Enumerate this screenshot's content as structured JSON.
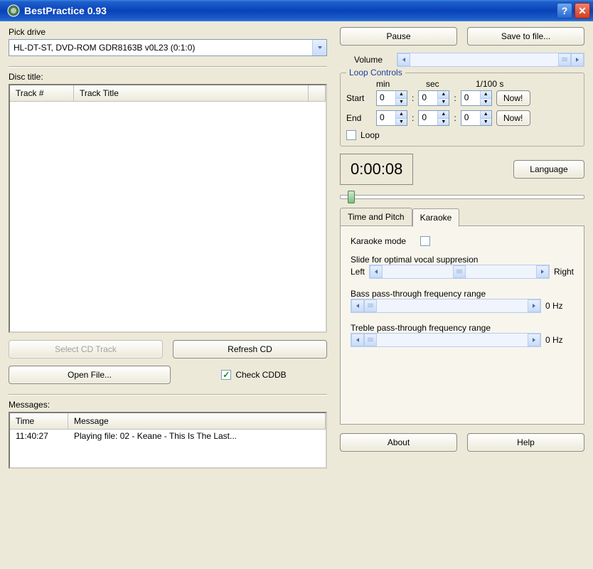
{
  "title": "BestPractice 0.93",
  "left": {
    "pick_drive_label": "Pick drive",
    "drive_value": "HL-DT-ST, DVD-ROM GDR8163B v0L23 (0:1:0)",
    "disc_title_label": "Disc title:",
    "track_num_header": "Track #",
    "track_title_header": "Track Title",
    "select_cd_track": "Select CD Track",
    "refresh_cd": "Refresh CD",
    "open_file": "Open File...",
    "check_cddb": "Check CDDB",
    "messages_label": "Messages:",
    "msg_time_header": "Time",
    "msg_message_header": "Message",
    "msg_time": "11:40:27",
    "msg_text": "Playing file: 02 - Keane - This Is The Last..."
  },
  "right": {
    "pause": "Pause",
    "save_to_file": "Save to file...",
    "volume_label": "Volume",
    "loop_controls_legend": "Loop Controls",
    "min_label": "min",
    "sec_label": "sec",
    "hundredth_label": "1/100 s",
    "start_label": "Start",
    "end_label": "End",
    "start_min": "0",
    "start_sec": "0",
    "start_hs": "0",
    "end_min": "0",
    "end_sec": "0",
    "end_hs": "0",
    "now": "Now!",
    "loop_checkbox": "Loop",
    "time_display": "0:00:08",
    "language": "Language",
    "tab_time_pitch": "Time and Pitch",
    "tab_karaoke": "Karaoke",
    "karaoke_mode": "Karaoke mode",
    "slide_label": "Slide for optimal vocal suppresion",
    "left_label": "Left",
    "right_label": "Right",
    "bass_label": "Bass pass-through frequency range",
    "bass_value": "0 Hz",
    "treble_label": "Treble pass-through frequency range",
    "treble_value": "0 Hz",
    "about": "About",
    "help": "Help"
  }
}
